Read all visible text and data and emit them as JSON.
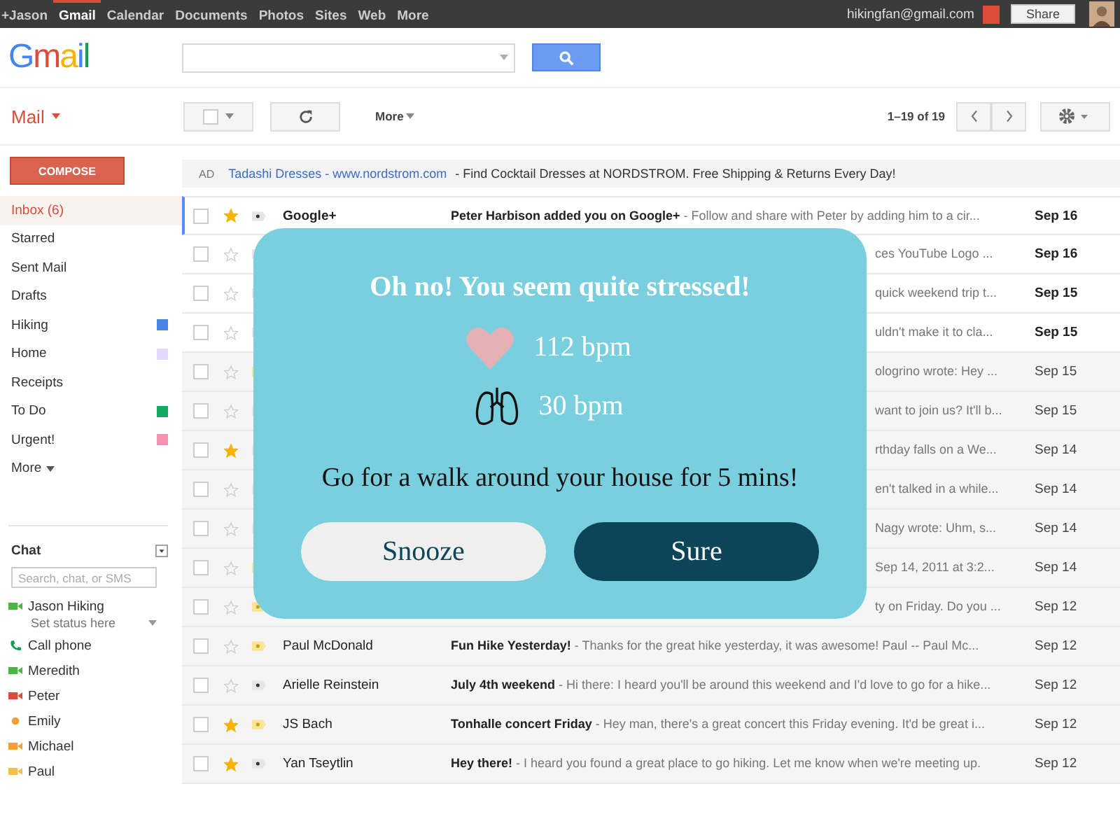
{
  "top_bar": {
    "links": [
      {
        "label": "+Jason",
        "selected": false
      },
      {
        "label": "Gmail",
        "selected": true
      },
      {
        "label": "Calendar",
        "selected": false
      },
      {
        "label": "Documents",
        "selected": false
      },
      {
        "label": "Photos",
        "selected": false
      },
      {
        "label": "Sites",
        "selected": false
      },
      {
        "label": "Web",
        "selected": false
      },
      {
        "label": "More",
        "selected": false
      }
    ],
    "account": "hikingfan@gmail.com",
    "share": "Share"
  },
  "header": {
    "logo": "Gmail"
  },
  "toolbar": {
    "mail_menu": "Mail",
    "more": "More",
    "range": "1–19 of 19"
  },
  "sidebar": {
    "compose": "COMPOSE",
    "items": [
      {
        "label": "Inbox (6)",
        "selected": true
      },
      {
        "label": "Starred",
        "selected": false
      },
      {
        "label": "Sent Mail",
        "selected": false
      },
      {
        "label": "Drafts",
        "selected": false
      },
      {
        "label": "Hiking",
        "selected": false,
        "color": "#4a86e8"
      },
      {
        "label": "Home",
        "selected": false,
        "color": "#e3d7ff"
      },
      {
        "label": "Receipts",
        "selected": false
      },
      {
        "label": "To Do",
        "selected": false,
        "color": "#16a765"
      },
      {
        "label": "Urgent!",
        "selected": false,
        "color": "#f691b2"
      }
    ],
    "more": "More",
    "chat": {
      "title": "Chat",
      "search_placeholder": "Search, chat, or SMS",
      "user": "Jason Hiking",
      "status": "Set status here",
      "contacts": [
        {
          "name": "Call phone",
          "kind": "phone",
          "color": "#0f9d58"
        },
        {
          "name": "Meredith",
          "kind": "video",
          "color": "#4bb543"
        },
        {
          "name": "Peter",
          "kind": "video",
          "color": "#dd4b39"
        },
        {
          "name": "Emily",
          "kind": "dot",
          "color": "#f0a030"
        },
        {
          "name": "Michael",
          "kind": "video",
          "color": "#f0a030"
        },
        {
          "name": "Paul",
          "kind": "video",
          "color": "#f5c04a"
        }
      ]
    }
  },
  "ad": {
    "tag": "AD",
    "link": "Tadashi Dresses - www.nordstrom.com",
    "text": "- Find Cocktail Dresses at NORDSTROM. Free Shipping & Returns Every Day!"
  },
  "emails": [
    {
      "sender": "Google+",
      "subject": "Peter Harbison added you on Google+",
      "snippet": "- Follow and share with Peter by adding him to a cir...",
      "date": "Sep 16",
      "starred": true,
      "important": false,
      "unread": true,
      "selected": false
    },
    {
      "snippet": "ces YouTube Logo ...",
      "date": "Sep 16",
      "starred": false,
      "important": false,
      "unread": true,
      "selected": false
    },
    {
      "snippet": "quick weekend trip t...",
      "date": "Sep 15",
      "starred": false,
      "important": false,
      "unread": true,
      "selected": false
    },
    {
      "snippet": "uldn't make it to cla...",
      "date": "Sep 15",
      "starred": false,
      "important": false,
      "unread": true,
      "selected": false
    },
    {
      "snippet": "ologrino wrote: Hey ...",
      "date": "Sep 15",
      "starred": false,
      "important": true,
      "unread": false,
      "selected": false
    },
    {
      "snippet": "want to join us? It'll b...",
      "date": "Sep 15",
      "starred": false,
      "important": false,
      "unread": false,
      "selected": false
    },
    {
      "snippet": "rthday falls on a We...",
      "date": "Sep 14",
      "starred": true,
      "important": false,
      "unread": false,
      "selected": false
    },
    {
      "snippet": "en't talked in a while...",
      "date": "Sep 14",
      "starred": false,
      "important": false,
      "unread": false,
      "selected": false
    },
    {
      "snippet": "Nagy wrote: Uhm, s...",
      "date": "Sep 14",
      "starred": false,
      "important": false,
      "unread": false,
      "selected": false
    },
    {
      "snippet": "Sep 14, 2011 at 3:2...",
      "date": "Sep 14",
      "starred": false,
      "important": true,
      "unread": false,
      "selected": false
    },
    {
      "snippet": "ty on Friday. Do you ...",
      "date": "Sep 12",
      "starred": false,
      "important": true,
      "unread": false,
      "selected": false
    },
    {
      "sender": "Paul McDonald",
      "subject": "Fun Hike Yesterday!",
      "snippet": "- Thanks for the great hike yesterday, it was awesome! Paul -- Paul Mc...",
      "date": "Sep 12",
      "starred": false,
      "important": true,
      "unread": false,
      "selected": false
    },
    {
      "sender": "Arielle Reinstein",
      "subject": "July 4th weekend",
      "snippet": "- Hi there: I heard you'll be around this weekend and I'd love to go for a hike...",
      "date": "Sep 12",
      "starred": false,
      "important": false,
      "unread": false,
      "selected": false
    },
    {
      "sender": "JS Bach",
      "subject": "Tonhalle concert Friday",
      "snippet": "- Hey man, there's a great concert this Friday evening. It'd be great i...",
      "date": "Sep 12",
      "starred": true,
      "important": true,
      "unread": false,
      "selected": false
    },
    {
      "sender": "Yan Tseytlin",
      "subject": "Hey there!",
      "snippet": "- I heard you found a great place to go hiking. Let me know when we're meeting up.",
      "date": "Sep 12",
      "starred": true,
      "important": false,
      "unread": false,
      "selected": false
    }
  ],
  "dialog": {
    "title": "Oh no! You seem quite stressed!",
    "heart_rate": "112 bpm",
    "breathing_rate": "30 bpm",
    "message": "Go for a walk around your house for 5 mins!",
    "buttons": [
      {
        "label": "Snooze",
        "kind": "secondary"
      },
      {
        "label": "Sure",
        "kind": "primary"
      }
    ]
  }
}
